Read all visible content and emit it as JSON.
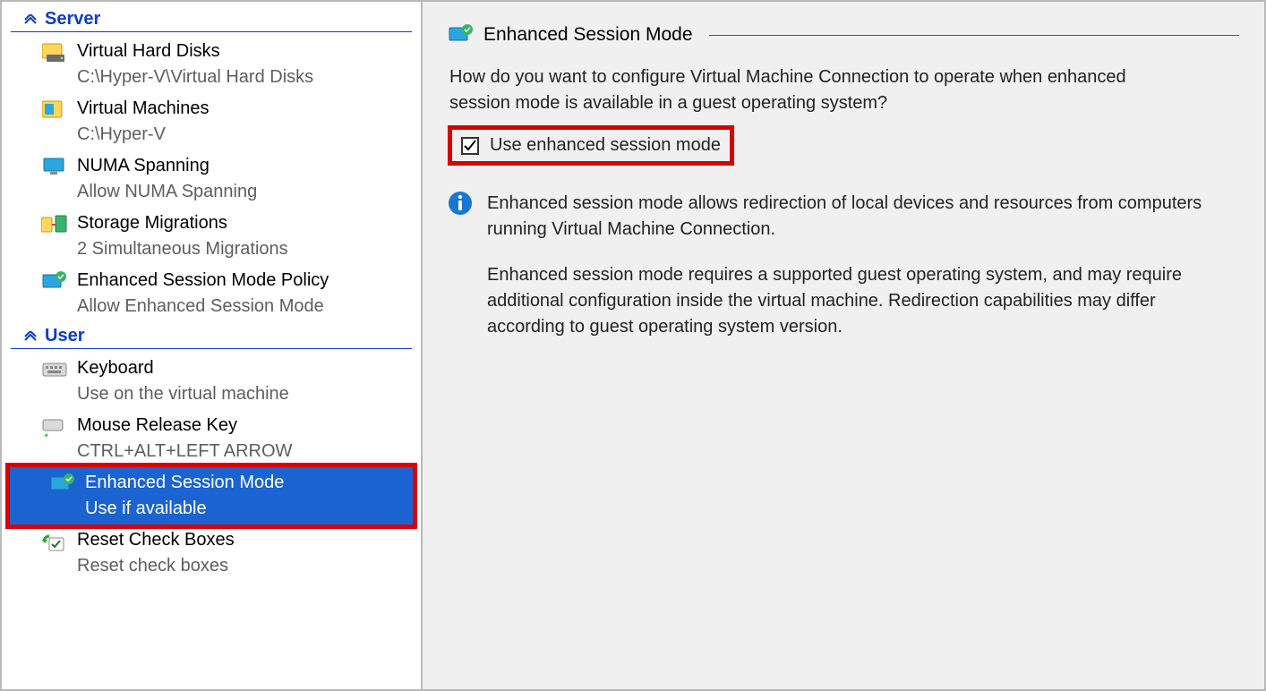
{
  "sections": {
    "server": {
      "header": "Server",
      "items": [
        {
          "title": "Virtual Hard Disks",
          "sub": "C:\\Hyper-V\\Virtual Hard Disks"
        },
        {
          "title": "Virtual Machines",
          "sub": "C:\\Hyper-V"
        },
        {
          "title": "NUMA Spanning",
          "sub": "Allow NUMA Spanning"
        },
        {
          "title": "Storage Migrations",
          "sub": "2 Simultaneous Migrations"
        },
        {
          "title": "Enhanced Session Mode Policy",
          "sub": "Allow Enhanced Session Mode"
        }
      ]
    },
    "user": {
      "header": "User",
      "items": [
        {
          "title": "Keyboard",
          "sub": "Use on the virtual machine"
        },
        {
          "title": "Mouse Release Key",
          "sub": "CTRL+ALT+LEFT ARROW"
        },
        {
          "title": "Enhanced Session Mode",
          "sub": "Use if available"
        },
        {
          "title": "Reset Check Boxes",
          "sub": "Reset check boxes"
        }
      ]
    }
  },
  "detail": {
    "title": "Enhanced Session Mode",
    "question": "How do you want to configure Virtual Machine Connection to operate when enhanced session mode is available in a guest operating system?",
    "checkbox_label": "Use enhanced session mode",
    "checkbox_checked": true,
    "info1": "Enhanced session mode allows redirection of local devices and resources from computers running Virtual Machine Connection.",
    "info2": "Enhanced session mode requires a supported guest operating system, and may require additional configuration inside the virtual machine. Redirection capabilities may differ according to guest operating system version."
  }
}
